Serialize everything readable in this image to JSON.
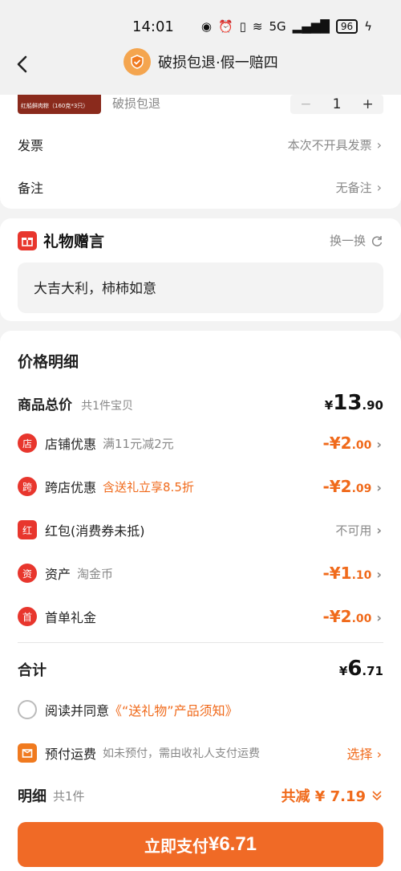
{
  "status_bar": {
    "time": "14:01",
    "network": "5G",
    "battery": "96"
  },
  "nav": {
    "title": "破损包退·假一赔四"
  },
  "product": {
    "thumb_text": "红船鲜肉粽（160克*3只）",
    "tag": "破损包退",
    "qty": "1",
    "minus": "−",
    "plus": "+"
  },
  "order_rows": {
    "invoice_label": "发票",
    "invoice_value": "本次不开具发票",
    "note_label": "备注",
    "note_value": "无备注"
  },
  "gift": {
    "title": "礼物赠言",
    "swap": "换一换",
    "message": "大吉大利，柿柿如意"
  },
  "price": {
    "section_title": "价格明细",
    "total_label": "商品总价",
    "total_sub": "共1件宝贝",
    "total_currency": "¥",
    "total_int": "13",
    "total_dec": ".90",
    "discounts": [
      {
        "icon": "店",
        "label": "店铺优惠",
        "desc": "满11元减2元",
        "int": "-¥2",
        "dec": ".00"
      },
      {
        "icon": "跨",
        "label": "跨店优惠",
        "desc": "含送礼立享8.5折",
        "int": "-¥2",
        "dec": ".09"
      },
      {
        "icon": "红",
        "label": "红包(消费券未抵)",
        "desc": "",
        "value": "不可用"
      },
      {
        "icon": "资",
        "label": "资产",
        "desc": "淘金币",
        "int": "-¥1",
        "dec": ".10"
      },
      {
        "icon": "首",
        "label": "首单礼金",
        "desc": "",
        "int": "-¥2",
        "dec": ".00"
      }
    ],
    "sum_label": "合计",
    "sum_currency": "¥",
    "sum_int": "6",
    "sum_dec": ".71"
  },
  "agreement": {
    "text": "阅读并同意",
    "link": "《“送礼物”产品须知》"
  },
  "shipping": {
    "label": "预付运费",
    "desc": "如未预付，需由收礼人支付运费",
    "action": "选择"
  },
  "bottom": {
    "detail_label": "明细",
    "detail_sub": "共1件",
    "save_text": "共减 ¥ 7.19",
    "pay_label": "立即支付",
    "pay_amount": "¥6.71"
  },
  "colors": {
    "accent": "#f06a26",
    "red": "#e8362d",
    "orange_text": "#f06a1b"
  }
}
